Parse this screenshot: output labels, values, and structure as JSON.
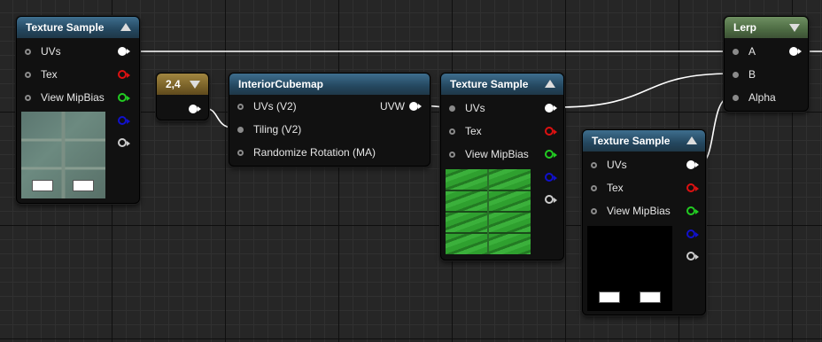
{
  "nodes": {
    "texsample1": {
      "title": "Texture Sample",
      "pins": {
        "uvs": "UVs",
        "tex": "Tex",
        "mip": "View MipBias"
      }
    },
    "const": {
      "title": "2,4"
    },
    "cubemap": {
      "title": "InteriorCubemap",
      "pins": {
        "uvs": "UVs (V2)",
        "tiling": "Tiling (V2)",
        "rand": "Randomize Rotation (MA)",
        "uvw": "UVW"
      }
    },
    "texsample2": {
      "title": "Texture Sample",
      "pins": {
        "uvs": "UVs",
        "tex": "Tex",
        "mip": "View MipBias"
      }
    },
    "texsample3": {
      "title": "Texture Sample",
      "pins": {
        "uvs": "UVs",
        "tex": "Tex",
        "mip": "View MipBias"
      }
    },
    "lerp": {
      "title": "Lerp",
      "pins": {
        "a": "A",
        "b": "B",
        "alpha": "Alpha"
      }
    }
  },
  "colors": {
    "red": "#d11",
    "green": "#2c2",
    "blue": "#11c",
    "white": "#ccc"
  }
}
